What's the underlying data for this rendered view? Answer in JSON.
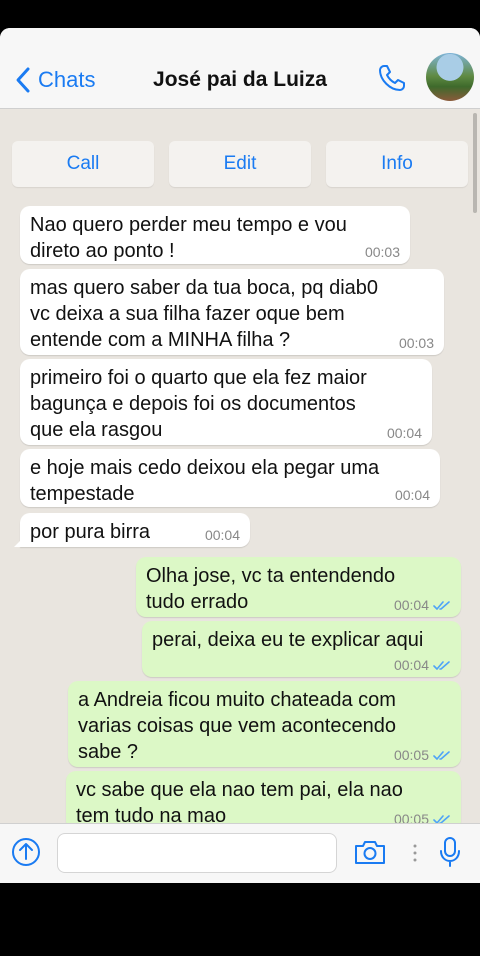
{
  "header": {
    "back_label": "Chats",
    "title": "José pai da Luiza"
  },
  "actions": {
    "call": "Call",
    "edit": "Edit",
    "info": "Info"
  },
  "messages": [
    {
      "dir": "in",
      "text": "Nao quero perder meu tempo e vou\ndireto ao ponto !",
      "time": "00:03"
    },
    {
      "dir": "in",
      "text": "mas quero saber da tua boca, pq diab0\nvc deixa a sua filha fazer oque bem\nentende com a MINHA filha ?",
      "time": "00:03"
    },
    {
      "dir": "in",
      "text": "primeiro foi o quarto que ela fez maior\nbagunça e depois foi os documentos\nque ela rasgou",
      "time": "00:04"
    },
    {
      "dir": "in",
      "text": "e hoje mais cedo deixou ela pegar uma\ntempestade",
      "time": "00:04"
    },
    {
      "dir": "in",
      "text": "por pura birra",
      "time": "00:04"
    },
    {
      "dir": "out",
      "text": "Olha jose, vc ta entendendo\ntudo errado",
      "time": "00:04"
    },
    {
      "dir": "out",
      "text": "perai, deixa eu te explicar aqui",
      "time": "00:04"
    },
    {
      "dir": "out",
      "text": "a Andreia ficou muito chateada com\nvarias coisas que vem acontecendo\nsabe ?",
      "time": "00:05"
    },
    {
      "dir": "out",
      "text": "vc sabe que ela nao tem pai, ela nao\ntem tudo na mao",
      "time": "00:05"
    }
  ],
  "composer": {
    "placeholder": ""
  },
  "colors": {
    "accent": "#1a7bf2",
    "incoming_bubble": "#ffffff",
    "outgoing_bubble": "#dcf8c6",
    "chat_background": "#e9e5df",
    "read_checks": "#4fa3f7"
  },
  "icons": [
    "chevron-left-icon",
    "phone-icon",
    "avatar",
    "upload-icon",
    "camera-icon",
    "more-dots-icon",
    "microphone-icon",
    "double-check-icon"
  ]
}
